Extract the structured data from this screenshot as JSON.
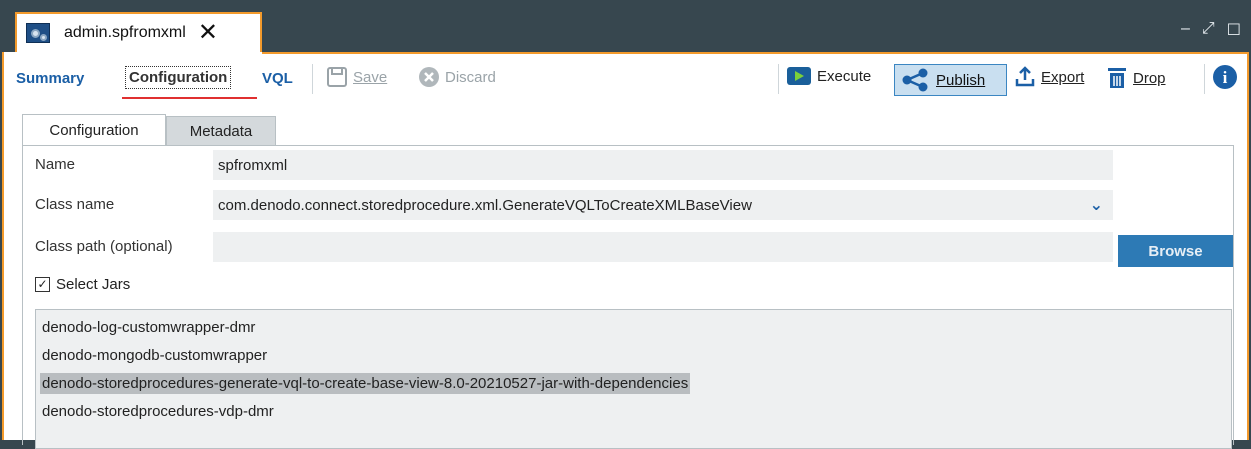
{
  "tab": {
    "title": "admin.spfromxml",
    "close_glyph": "✕"
  },
  "window_controls": {
    "minimize": "–",
    "restore": "⤢",
    "maximize": "☐"
  },
  "toolbar": {
    "summary": "Summary",
    "configuration": "Configuration",
    "vql": "VQL",
    "save": "Save",
    "discard": "Discard",
    "execute": "Execute",
    "publish": "Publish",
    "export": "Export",
    "drop": "Drop",
    "info_glyph": "i"
  },
  "subtabs": {
    "configuration": "Configuration",
    "metadata": "Metadata"
  },
  "form": {
    "name_label": "Name",
    "name_value": "spfromxml",
    "class_name_label": "Class name",
    "class_name_value": "com.denodo.connect.storedprocedure.xml.GenerateVQLToCreateXMLBaseView",
    "class_path_label": "Class path (optional)",
    "class_path_value": "",
    "browse": "Browse",
    "select_jars_label": "Select Jars",
    "select_jars_checked": true
  },
  "jars": [
    {
      "name": "denodo-log-customwrapper-dmr",
      "selected": false
    },
    {
      "name": "denodo-mongodb-customwrapper",
      "selected": false
    },
    {
      "name": "denodo-storedprocedures-generate-vql-to-create-base-view-8.0-20210527-jar-with-dependencies",
      "selected": true
    },
    {
      "name": "denodo-storedprocedures-vdp-dmr",
      "selected": false
    }
  ],
  "colors": {
    "accent_orange": "#f39a2c",
    "link_blue": "#1b5fa6",
    "browse_blue": "#2d7ab5",
    "titlebar": "#37474f"
  },
  "icons": [
    "view-icon",
    "close-icon",
    "save-icon",
    "discard-icon",
    "execute-icon",
    "publish-icon",
    "export-icon",
    "drop-icon",
    "info-icon",
    "chevron-down-icon",
    "checkbox-icon"
  ]
}
